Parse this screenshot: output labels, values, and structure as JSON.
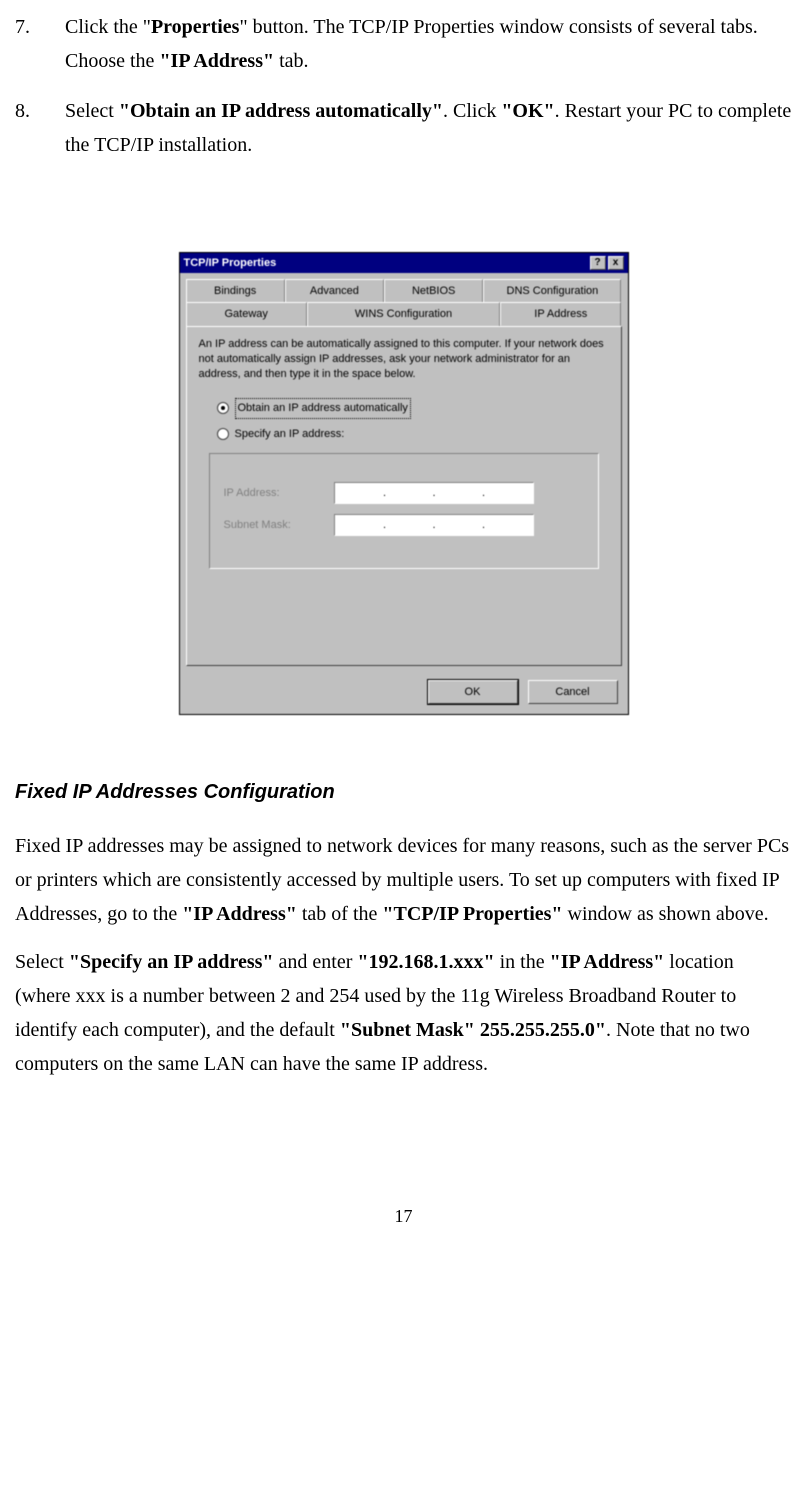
{
  "list": {
    "item7": {
      "num": "7.",
      "t1": "Click the \"",
      "b1": "Properties",
      "t2": "\" button. The TCP/IP Properties window consists of several tabs. Choose the ",
      "b2": "\"IP Address\"",
      "t3": " tab."
    },
    "item8": {
      "num": "8.",
      "t1": "Select ",
      "b1": "\"Obtain an IP address automatically\"",
      "t2": ". Click ",
      "b2": "\"OK\"",
      "t3": ". Restart your PC to complete the TCP/IP installation."
    }
  },
  "dialog": {
    "title": "TCP/IP Properties",
    "help_glyph": "?",
    "close_glyph": "x",
    "tabs_back": [
      "Bindings",
      "Advanced",
      "NetBIOS",
      "DNS Configuration"
    ],
    "tabs_front": [
      "Gateway",
      "WINS Configuration",
      "IP Address"
    ],
    "desc": "An IP address can be automatically assigned to this computer. If your network does not automatically assign IP addresses, ask your network administrator for an address, and then type it in the space below.",
    "radio1": "Obtain an IP address automatically",
    "radio2": "Specify an IP address:",
    "field_ip": "IP Address:",
    "field_mask": "Subnet Mask:",
    "btn_ok": "OK",
    "btn_cancel": "Cancel"
  },
  "section": {
    "heading": "Fixed IP Addresses Configuration",
    "p1a": "Fixed IP addresses may be assigned to network devices for many reasons, such as the server PCs or printers   which are consistently accessed by multiple users. To set up computers with fixed IP Addresses, go to the ",
    "p1b": "\"IP Address\"",
    "p1c": " tab of the ",
    "p1d": "\"TCP/IP Properties\"",
    "p1e": " window as shown above.",
    "p2a": "Select ",
    "p2b": "\"Specify an IP address\"",
    "p2c": " and enter ",
    "p2d": "\"192.168.1.xxx\"",
    "p2e": " in the ",
    "p2f": "\"IP Address\"",
    "p2g": " location (where xxx is a number between 2 and 254 used by the 11g Wireless Broadband Router to identify each computer), and the default ",
    "p2h": "\"Subnet Mask\" 255.255.255.0\"",
    "p2i": ". Note that no two computers on the same LAN can have the same IP address."
  },
  "page_number": "17"
}
